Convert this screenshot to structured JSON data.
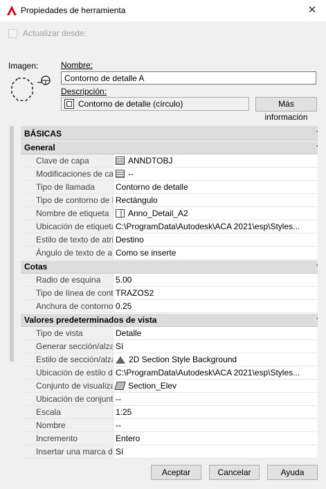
{
  "window": {
    "title": "Propiedades de herramienta",
    "close_symbol": "✕"
  },
  "update_from": {
    "label": "Actualizar desde:",
    "checked": false
  },
  "image": {
    "label": "Imagen:",
    "icon": "octagon-detail-boundary-icon"
  },
  "name": {
    "label": "Nombre:",
    "value": "Contorno de detalle A"
  },
  "description": {
    "label": "Descripción:",
    "value": "Contorno de detalle (círculo)",
    "more_info_button": "Más información"
  },
  "properties": {
    "top_section": "BÁSICAS",
    "sections": [
      {
        "title": "General",
        "rows": [
          {
            "key": "Clave de capa",
            "value": "ANNDTOBJ",
            "icon": "table-icon"
          },
          {
            "key": "Modificaciones de ca...",
            "value": "--",
            "icon": "table-icon"
          },
          {
            "key": "Tipo de llamada",
            "value": "Contorno de detalle",
            "icon": ""
          },
          {
            "key": "Tipo de contorno de l...",
            "value": "Rectángulo",
            "icon": ""
          },
          {
            "key": "Nombre de etiqueta",
            "value": "Anno_Detail_A2",
            "icon": "tag-icon"
          },
          {
            "key": "Ubicación de etiqueta",
            "value": "C:\\ProgramData\\Autodesk\\ACA  2021\\esp\\Styles...",
            "icon": ""
          },
          {
            "key": "Estilo de texto de atri...",
            "value": "Destino",
            "icon": ""
          },
          {
            "key": "Ángulo de texto de a...",
            "value": "Como se inserte",
            "icon": ""
          }
        ]
      },
      {
        "title": "Cotas",
        "rows": [
          {
            "key": "Radio de esquina",
            "value": "5.00",
            "icon": ""
          },
          {
            "key": "Tipo de línea de cont...",
            "value": "TRAZOS2",
            "icon": ""
          },
          {
            "key": "Anchura de contorno",
            "value": "0.25",
            "icon": ""
          }
        ]
      },
      {
        "title": "Valores predeterminados de vista",
        "rows": [
          {
            "key": "Tipo de vista",
            "value": "Detalle",
            "icon": ""
          },
          {
            "key": "Generar  sección/alza...",
            "value": "Sí",
            "icon": ""
          },
          {
            "key": "Estilo de sección/alza...",
            "value": "2D Section Style Background",
            "icon": "house-icon"
          },
          {
            "key": "Ubicación de estilo d...",
            "value": "C:\\ProgramData\\Autodesk\\ACA  2021\\esp\\Styles...",
            "icon": ""
          },
          {
            "key": "Conjunto de visualiza...",
            "value": "Section_Elev",
            "icon": "box-icon"
          },
          {
            "key": "Ubicación de conjunt...",
            "value": "--",
            "icon": ""
          },
          {
            "key": "Escala",
            "value": "1:25",
            "icon": ""
          },
          {
            "key": "Nombre",
            "value": "--",
            "icon": ""
          },
          {
            "key": "Incremento",
            "value": "Entero",
            "icon": ""
          },
          {
            "key": "Insertar una marca d...",
            "value": "Sí",
            "icon": ""
          }
        ]
      }
    ]
  },
  "buttons": {
    "ok": "Aceptar",
    "cancel": "Cancelar",
    "help": "Ayuda"
  }
}
